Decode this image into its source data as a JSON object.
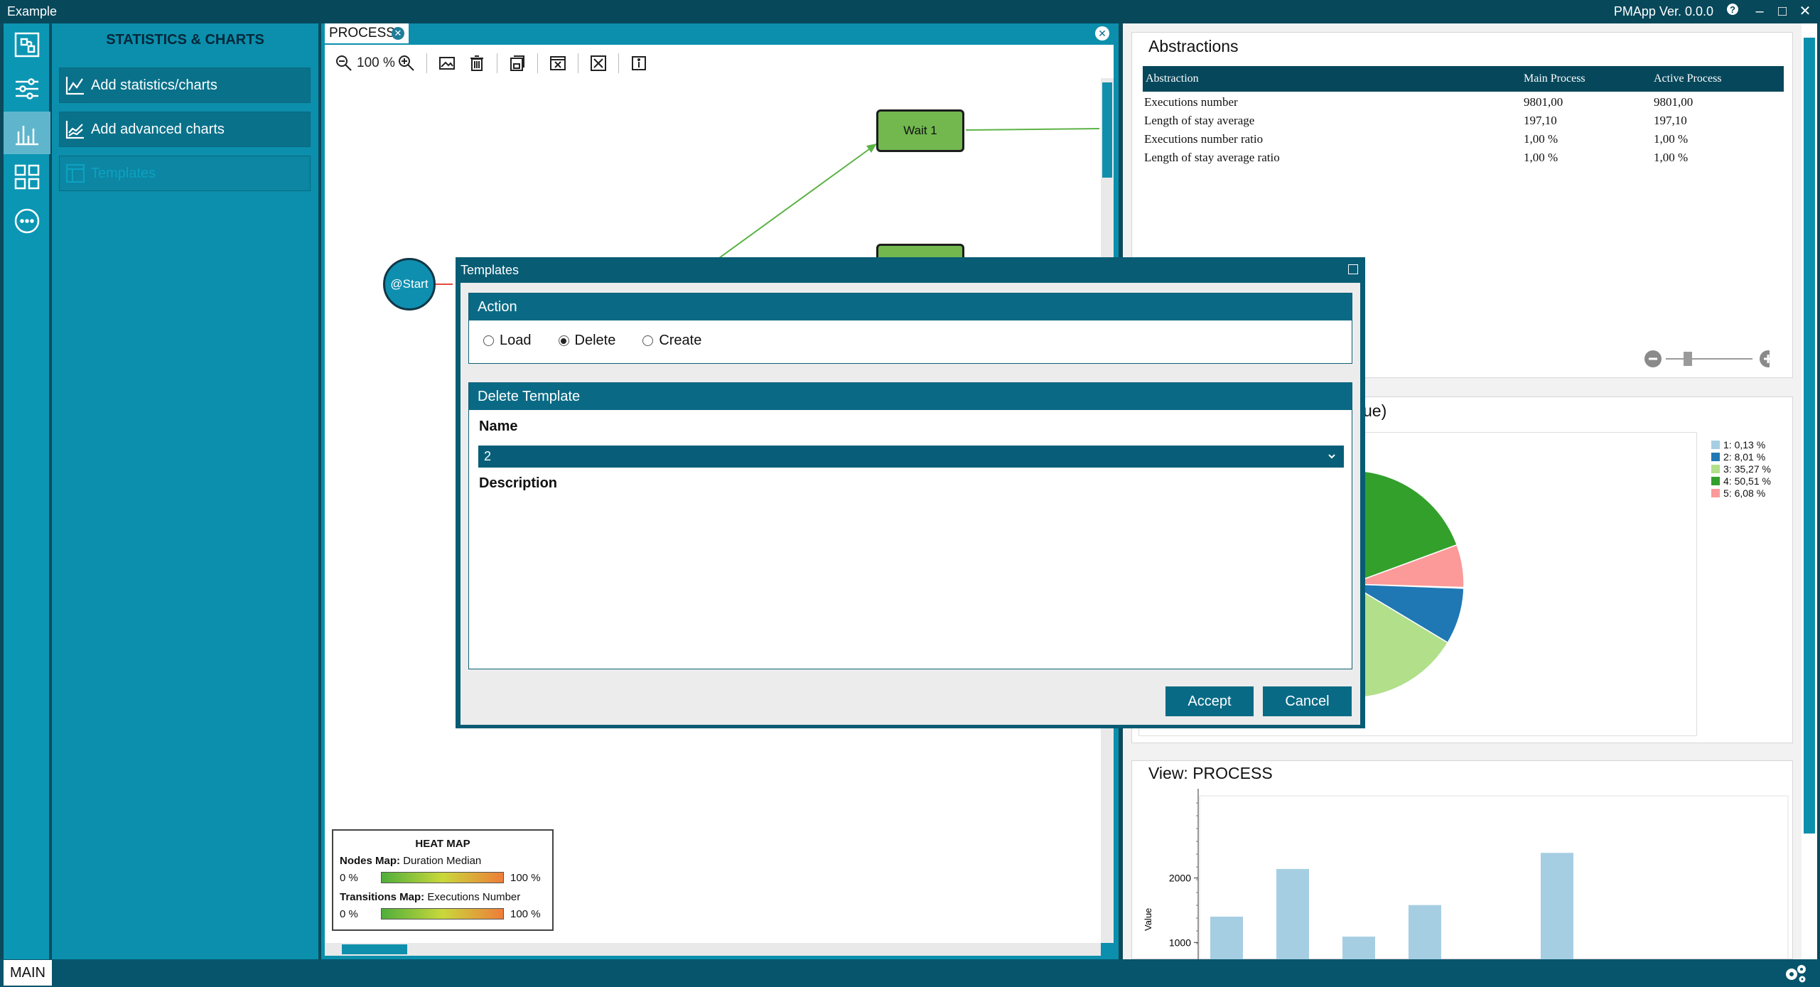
{
  "window": {
    "title": "Example",
    "version": "PMApp Ver. 0.0.0",
    "help_icon": "question-icon",
    "minimize": "–",
    "maximize": "□",
    "close": "✕"
  },
  "left_panel": {
    "title": "STATISTICS & CHARTS",
    "buttons": [
      {
        "label": "Add statistics/charts",
        "icon": "line-chart-icon"
      },
      {
        "label": "Add advanced charts",
        "icon": "area-chart-icon"
      },
      {
        "label": "Templates",
        "icon": "template-icon"
      }
    ]
  },
  "process": {
    "tab_label": "PROCESS",
    "zoom": "100 %",
    "nodes": {
      "wait": "Wait 1",
      "start": "@Start"
    },
    "heatmap": {
      "title": "HEAT MAP",
      "nodes_map_label": "Nodes Map:",
      "nodes_map_value": "Duration Median",
      "transitions_map_label": "Transitions Map:",
      "transitions_map_value": "Executions Number",
      "min": "0 %",
      "max": "100 %"
    }
  },
  "abstractions": {
    "title": "Abstractions",
    "headers": [
      "Abstraction",
      "Main Process",
      "Active Process"
    ],
    "rows": [
      [
        "Executions number",
        "9801,00",
        "9801,00"
      ],
      [
        "Length of stay average",
        "197,10",
        "197,10"
      ],
      [
        "Executions number ratio",
        "1,00 %",
        "1,00 %"
      ],
      [
        "Length of stay average ratio",
        "1,00 %",
        "1,00 %"
      ]
    ]
  },
  "pie_panel": {
    "title_fragment": "ue)",
    "legend": [
      {
        "label": "1: 0,13 %",
        "color": "#a6cee3"
      },
      {
        "label": "2: 8,01 %",
        "color": "#1f78b4"
      },
      {
        "label": "3: 35,27 %",
        "color": "#b2df8a"
      },
      {
        "label": "4: 50,51 %",
        "color": "#33a02c"
      },
      {
        "label": "5: 6,08 %",
        "color": "#fb9a99"
      }
    ]
  },
  "view_panel": {
    "title": "View: PROCESS",
    "ylabel": "Value",
    "ticks": [
      "2000",
      "1000"
    ]
  },
  "chart_data": {
    "type": "bar",
    "ylabel": "Value",
    "ylim": [
      0,
      2300
    ],
    "values": [
      1400,
      2140,
      1090,
      1580,
      0,
      2390
    ],
    "color": "#a6cee3"
  },
  "dialog": {
    "title": "Templates",
    "action_section": "Action",
    "radios": [
      {
        "label": "Load",
        "checked": false
      },
      {
        "label": "Delete",
        "checked": true
      },
      {
        "label": "Create",
        "checked": false
      }
    ],
    "delete_section": "Delete Template",
    "name_label": "Name",
    "name_value": "2",
    "description_label": "Description",
    "accept": "Accept",
    "cancel": "Cancel"
  },
  "status_bar": {
    "main": "MAIN",
    "settings_icon": "gears-icon"
  }
}
